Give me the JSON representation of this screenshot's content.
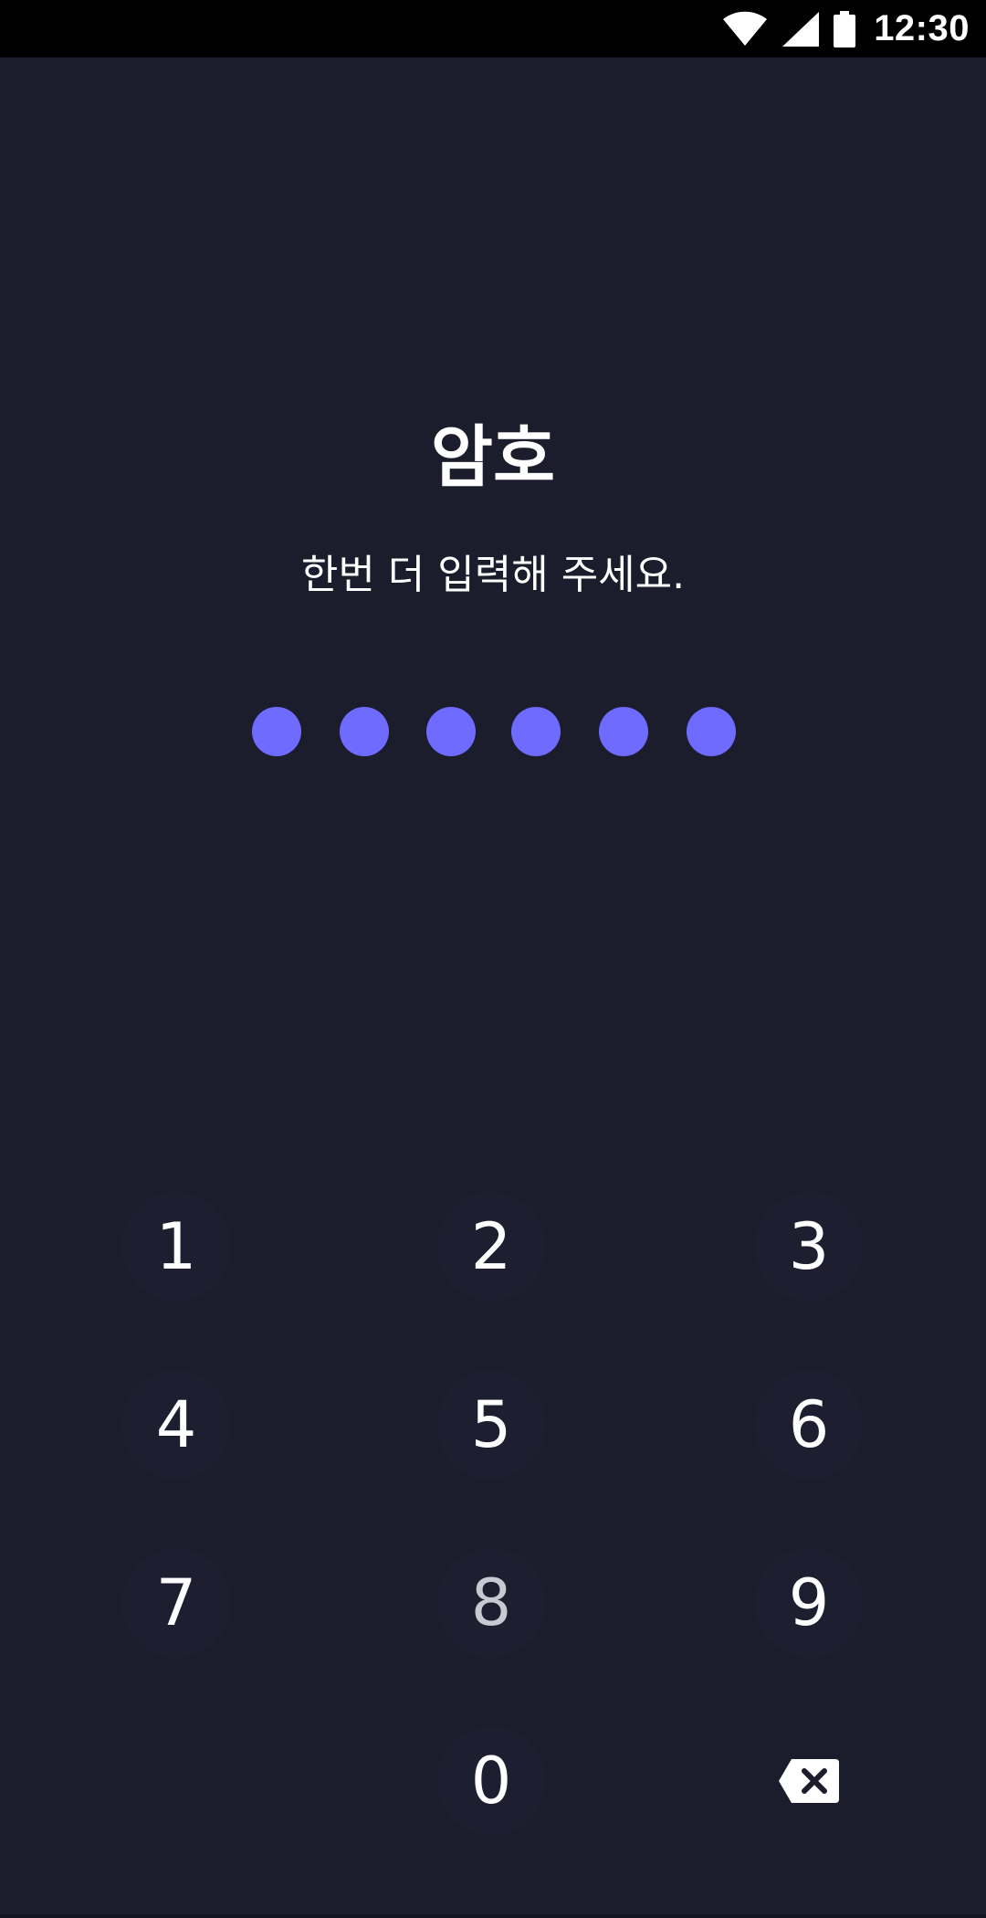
{
  "status_bar": {
    "time": "12:30",
    "icons": [
      "wifi-icon",
      "cellular-signal-icon",
      "battery-icon"
    ]
  },
  "title": "암호",
  "subtitle": "한번 더 입력해 주세요.",
  "pin": {
    "length": 6,
    "filled": 6,
    "dot_color": "#6f6bff"
  },
  "keypad": {
    "keys": [
      {
        "name": "key-1",
        "label": "1"
      },
      {
        "name": "key-2",
        "label": "2"
      },
      {
        "name": "key-3",
        "label": "3"
      },
      {
        "name": "key-4",
        "label": "4"
      },
      {
        "name": "key-5",
        "label": "5"
      },
      {
        "name": "key-6",
        "label": "6"
      },
      {
        "name": "key-7",
        "label": "7"
      },
      {
        "name": "key-8",
        "label": "8"
      },
      {
        "name": "key-9",
        "label": "9"
      },
      {
        "name": "key-0",
        "label": "0"
      }
    ],
    "backspace_icon": "backspace-icon"
  },
  "colors": {
    "background": "#1b1c2c",
    "status_bar": "#000000",
    "accent": "#6f6bff",
    "text": "#ffffff"
  }
}
